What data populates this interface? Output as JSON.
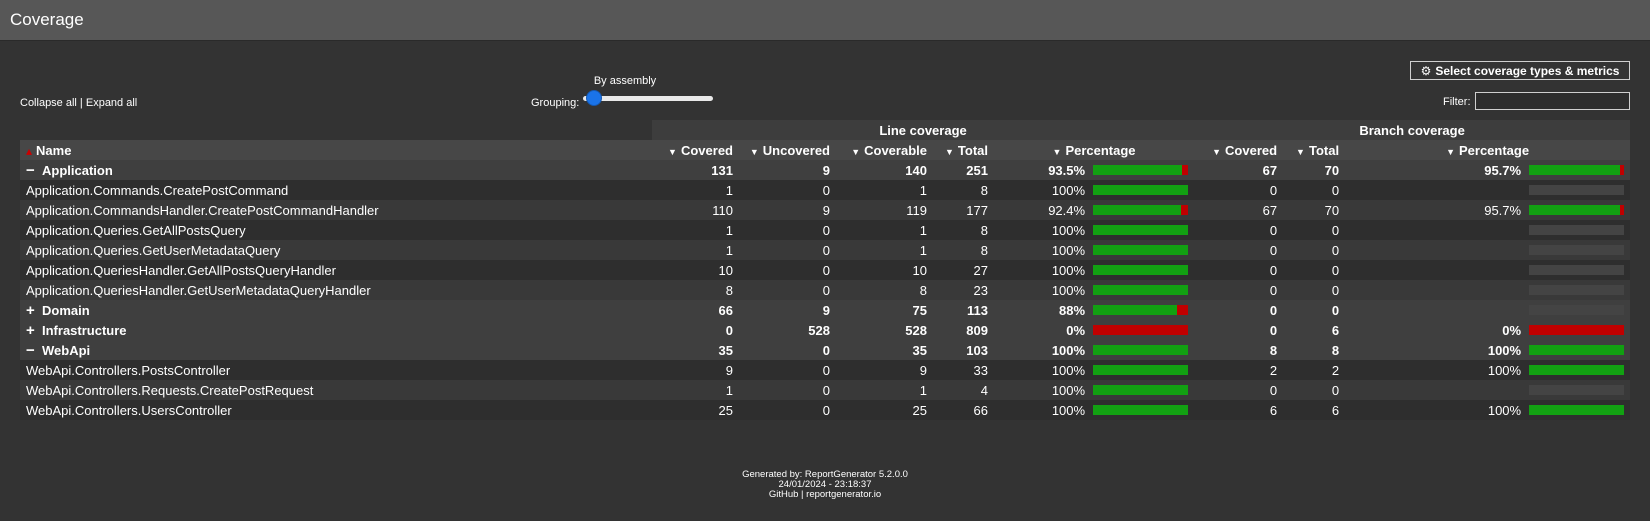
{
  "header": {
    "title": "Coverage"
  },
  "toolbar": {
    "collapse_all": "Collapse all",
    "separator": " | ",
    "expand_all": "Expand all",
    "grouping_label": "Grouping:",
    "grouping_value": "By assembly",
    "grouping_level": 0,
    "select_button": "Select coverage types & metrics",
    "filter_label": "Filter:",
    "filter_value": ""
  },
  "table": {
    "group_headers": {
      "line": "Line coverage",
      "branch": "Branch coverage"
    },
    "columns": {
      "name": "Name",
      "covered": "Covered",
      "uncovered": "Uncovered",
      "coverable": "Coverable",
      "total": "Total",
      "percentage": "Percentage",
      "b_covered": "Covered",
      "b_total": "Total",
      "b_percentage": "Percentage"
    },
    "rows": [
      {
        "kind": "group",
        "sign": "−",
        "name": "Application",
        "covered": "131",
        "uncovered": "9",
        "coverable": "140",
        "total": "251",
        "pct": "93.5%",
        "pct_value": 93.5,
        "b_covered": "67",
        "b_total": "70",
        "b_pct": "95.7%",
        "b_pct_value": 95.7
      },
      {
        "kind": "item",
        "name": "Application.Commands.CreatePostCommand",
        "covered": "1",
        "uncovered": "0",
        "coverable": "1",
        "total": "8",
        "pct": "100%",
        "pct_value": 100,
        "b_covered": "0",
        "b_total": "0",
        "b_pct": "",
        "b_pct_value": null
      },
      {
        "kind": "item",
        "name": "Application.CommandsHandler.CreatePostCommandHandler",
        "covered": "110",
        "uncovered": "9",
        "coverable": "119",
        "total": "177",
        "pct": "92.4%",
        "pct_value": 92.4,
        "b_covered": "67",
        "b_total": "70",
        "b_pct": "95.7%",
        "b_pct_value": 95.7
      },
      {
        "kind": "item",
        "name": "Application.Queries.GetAllPostsQuery",
        "covered": "1",
        "uncovered": "0",
        "coverable": "1",
        "total": "8",
        "pct": "100%",
        "pct_value": 100,
        "b_covered": "0",
        "b_total": "0",
        "b_pct": "",
        "b_pct_value": null
      },
      {
        "kind": "item",
        "name": "Application.Queries.GetUserMetadataQuery",
        "covered": "1",
        "uncovered": "0",
        "coverable": "1",
        "total": "8",
        "pct": "100%",
        "pct_value": 100,
        "b_covered": "0",
        "b_total": "0",
        "b_pct": "",
        "b_pct_value": null
      },
      {
        "kind": "item",
        "name": "Application.QueriesHandler.GetAllPostsQueryHandler",
        "covered": "10",
        "uncovered": "0",
        "coverable": "10",
        "total": "27",
        "pct": "100%",
        "pct_value": 100,
        "b_covered": "0",
        "b_total": "0",
        "b_pct": "",
        "b_pct_value": null
      },
      {
        "kind": "item",
        "name": "Application.QueriesHandler.GetUserMetadataQueryHandler",
        "covered": "8",
        "uncovered": "0",
        "coverable": "8",
        "total": "23",
        "pct": "100%",
        "pct_value": 100,
        "b_covered": "0",
        "b_total": "0",
        "b_pct": "",
        "b_pct_value": null
      },
      {
        "kind": "group",
        "sign": "+",
        "name": "Domain",
        "covered": "66",
        "uncovered": "9",
        "coverable": "75",
        "total": "113",
        "pct": "88%",
        "pct_value": 88,
        "b_covered": "0",
        "b_total": "0",
        "b_pct": "",
        "b_pct_value": null
      },
      {
        "kind": "group",
        "sign": "+",
        "name": "Infrastructure",
        "covered": "0",
        "uncovered": "528",
        "coverable": "528",
        "total": "809",
        "pct": "0%",
        "pct_value": 0,
        "b_covered": "0",
        "b_total": "6",
        "b_pct": "0%",
        "b_pct_value": 0
      },
      {
        "kind": "group",
        "sign": "−",
        "name": "WebApi",
        "covered": "35",
        "uncovered": "0",
        "coverable": "35",
        "total": "103",
        "pct": "100%",
        "pct_value": 100,
        "b_covered": "8",
        "b_total": "8",
        "b_pct": "100%",
        "b_pct_value": 100
      },
      {
        "kind": "item",
        "name": "WebApi.Controllers.PostsController",
        "covered": "9",
        "uncovered": "0",
        "coverable": "9",
        "total": "33",
        "pct": "100%",
        "pct_value": 100,
        "b_covered": "2",
        "b_total": "2",
        "b_pct": "100%",
        "b_pct_value": 100
      },
      {
        "kind": "item",
        "name": "WebApi.Controllers.Requests.CreatePostRequest",
        "covered": "1",
        "uncovered": "0",
        "coverable": "1",
        "total": "4",
        "pct": "100%",
        "pct_value": 100,
        "b_covered": "0",
        "b_total": "0",
        "b_pct": "",
        "b_pct_value": null
      },
      {
        "kind": "item",
        "name": "WebApi.Controllers.UsersController",
        "covered": "25",
        "uncovered": "0",
        "coverable": "25",
        "total": "66",
        "pct": "100%",
        "pct_value": 100,
        "b_covered": "6",
        "b_total": "6",
        "b_pct": "100%",
        "b_pct_value": 100
      }
    ]
  },
  "footer": {
    "generated_by": "Generated by: ReportGenerator 5.2.0.0",
    "timestamp": "24/01/2024 - 23:18:37",
    "github": "GitHub",
    "separator": " | ",
    "site": "reportgenerator.io"
  },
  "colors": {
    "covered": "#12a012",
    "uncovered": "#c00000",
    "empty": "#444444"
  }
}
